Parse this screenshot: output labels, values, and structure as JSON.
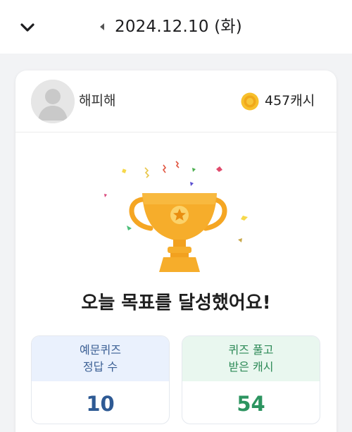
{
  "header": {
    "date": "2024.12.10 (화)",
    "collapse_icon": "chevron-down-icon",
    "prev_icon": "caret-left-icon"
  },
  "profile": {
    "name": "해피해",
    "cash": "457캐시",
    "avatar_icon": "user-avatar-icon",
    "coin_icon": "coin-icon"
  },
  "goal": {
    "message": "오늘 목표를 달성했어요!",
    "image_icon": "trophy-icon"
  },
  "stats": [
    {
      "label_line1": "예문퀴즈",
      "label_line2": "정답 수",
      "value": "10",
      "color": "#2e5a94"
    },
    {
      "label_line1": "퀴즈 풀고",
      "label_line2": "받은 캐시",
      "value": "54",
      "color": "#2c9460"
    }
  ],
  "colors": {
    "trophy": "#f5a623",
    "coin": "#f3b51b",
    "blue_tile": "#eaf1fd",
    "green_tile": "#e9f7ef"
  }
}
